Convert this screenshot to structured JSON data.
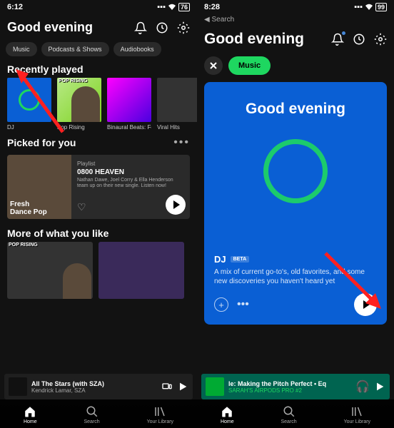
{
  "left": {
    "status": {
      "time": "6:12",
      "battery": "76"
    },
    "greeting": "Good evening",
    "chips": [
      "Music",
      "Podcasts & Shows",
      "Audiobooks"
    ],
    "recent": {
      "title": "Recently played",
      "items": [
        {
          "label": "DJ"
        },
        {
          "label": "Pop Rising"
        },
        {
          "label": "Binaural Beats: Focus"
        },
        {
          "label": "Viral Hits"
        }
      ]
    },
    "picked": {
      "title": "Picked for you",
      "tag": "Playlist",
      "name": "0800 HEAVEN",
      "desc": "Nathan Dawe, Joel Corry & Ella Henderson team up on their new single. Listen now!",
      "overlay": "Fresh Dance Pop"
    },
    "more": {
      "title": "More of what you like"
    },
    "nowPlaying": {
      "title": "All The Stars (with SZA)",
      "artist": "Kendrick Lamar, SZA"
    },
    "nav": [
      "Home",
      "Search",
      "Your Library"
    ]
  },
  "right": {
    "status": {
      "time": "8:28",
      "search": "Search",
      "battery": "99"
    },
    "greeting": "Good evening",
    "chip": "Music",
    "dj": {
      "heading": "Good evening",
      "name": "DJ",
      "badge": "BETA",
      "desc": "A mix of current go-to's, old favorites, and some new discoveries you haven't heard yet"
    },
    "nowPlaying": {
      "title": "le: Making the Pitch Perfect • Eq",
      "subtitle": "SARAH'S AIRPODS PRO #2"
    },
    "nav": [
      "Home",
      "Search",
      "Your Library"
    ]
  }
}
